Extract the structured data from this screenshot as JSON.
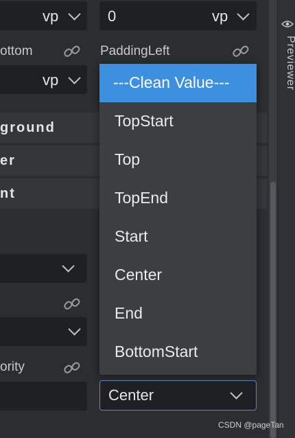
{
  "top_row": {
    "left_unit": "vp",
    "right_value": "0",
    "right_unit": "vp"
  },
  "labels": {
    "padding_bottom_partial": "ottom",
    "padding_left": "PaddingLeft"
  },
  "second_row": {
    "left_unit": "vp"
  },
  "sections": {
    "background_partial": "ground",
    "border_partial": "er",
    "font_partial": "nt"
  },
  "priority_label_partial": "ority",
  "dropdown": {
    "options": [
      "---Clean Value---",
      "TopStart",
      "Top",
      "TopEnd",
      "Start",
      "Center",
      "End",
      "BottomStart"
    ],
    "selected_index": 0
  },
  "align_select": {
    "value": "Center"
  },
  "right_rail": {
    "title": "Previewer"
  },
  "watermark": "CSDN @pageTan",
  "colors": {
    "accent": "#3d8fe0",
    "background": "#2b2d30",
    "field": "#1f2024",
    "dropdown": "#3c3e42"
  }
}
